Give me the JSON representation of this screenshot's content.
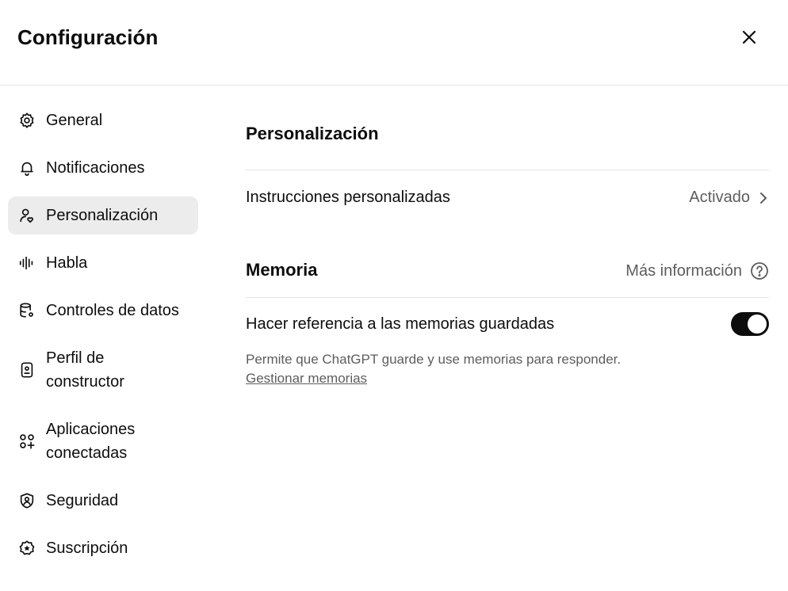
{
  "header": {
    "title": "Configuración"
  },
  "sidebar": {
    "items": [
      {
        "label": "General",
        "icon": "gear-icon"
      },
      {
        "label": "Notificaciones",
        "icon": "bell-icon"
      },
      {
        "label": "Personalización",
        "icon": "user-heart-icon",
        "active": true
      },
      {
        "label": "Habla",
        "icon": "waveform-icon"
      },
      {
        "label": "Controles de datos",
        "icon": "database-gear-icon"
      },
      {
        "label": "Perfil de constructor",
        "icon": "id-badge-icon"
      },
      {
        "label": "Aplicaciones conectadas",
        "icon": "apps-plus-icon"
      },
      {
        "label": "Seguridad",
        "icon": "shield-user-icon"
      },
      {
        "label": "Suscripción",
        "icon": "badge-star-icon"
      }
    ]
  },
  "main": {
    "personalization": {
      "title": "Personalización",
      "custom_instructions": {
        "label": "Instrucciones personalizadas",
        "value": "Activado"
      }
    },
    "memory": {
      "title": "Memoria",
      "learn_more": "Más información",
      "reference_saved": {
        "label": "Hacer referencia a las memorias guardadas",
        "enabled": true
      },
      "description": "Permite que ChatGPT guarde y use memorias para responder.",
      "manage_link": "Gestionar memorias"
    }
  },
  "colors": {
    "text": "#0d0d0d",
    "muted": "#5d5d5d",
    "active_bg": "#ececec",
    "divider": "#e5e5e5",
    "toggle_on": "#0d0d0d"
  }
}
